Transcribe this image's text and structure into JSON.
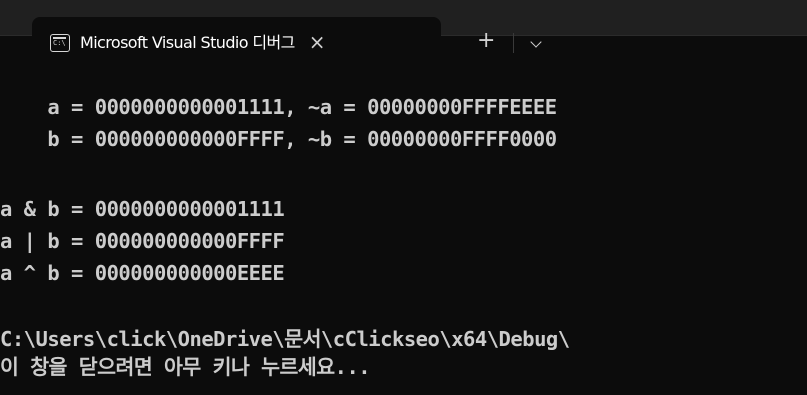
{
  "tab": {
    "icon_text": "C:\\",
    "title": "Microsoft Visual Studio 디버그",
    "close_glyph": "×",
    "new_tab_glyph": "+"
  },
  "console": {
    "lines": [
      "    a = 0000000000001111, ~a = 00000000FFFFEEEE",
      "    b = 000000000000FFFF, ~b = 00000000FFFF0000",
      "a & b = 0000000000001111",
      "a | b = 000000000000FFFF",
      "a ^ b = 000000000000EEEE",
      "C:\\Users\\click\\OneDrive\\문서\\cClickseo\\x64\\Debug\\",
      "이 창을 닫으려면 아무 키나 누르세요..."
    ]
  },
  "colors": {
    "background": "#0c0c0c",
    "tabbar": "#202020",
    "text": "#cccccc"
  }
}
